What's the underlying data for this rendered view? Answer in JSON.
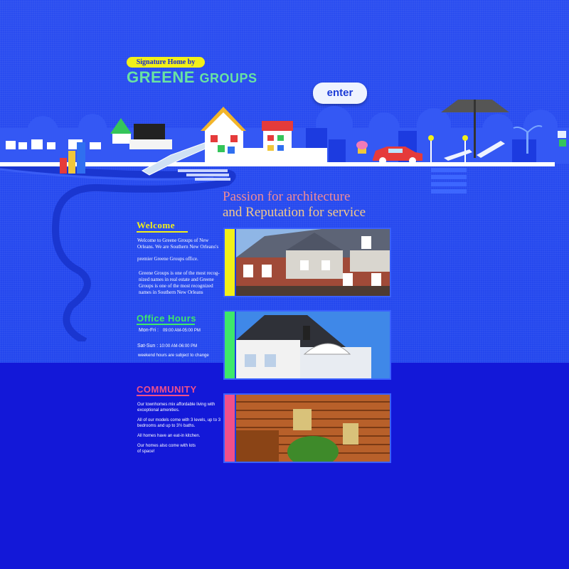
{
  "header": {
    "badge": "Signature Home by",
    "logo_main": "GREENE",
    "logo_sub": "GROUPS",
    "enter_label": "enter"
  },
  "tagline": {
    "line1": "Passion for architecture",
    "line2": "and Reputation for service"
  },
  "welcome": {
    "title": "Welcome",
    "para1a": "Welcome to Greene Groups of New",
    "para1b": "Orleans. We are Southern New Orleans's",
    "para1c": "premier Greene Groups office.",
    "para2a": "Greene Groups is one of the most recog-",
    "para2b": "nized names in real estate and Greene",
    "para2c": "Groups is one of the most recognized",
    "para2d": "names in Southern New Orleans"
  },
  "office": {
    "title": "Office Hours",
    "row1_day": "Mon-Fri :",
    "row1_time": "09:00 AM-05:00 PM",
    "row2_day": "Sat-Sun :",
    "row2_time": "10:00 AM-06:00 PM",
    "note": "weekend hours are subject to change"
  },
  "community": {
    "title": "COMMUNITY",
    "p1a": "Our townhomes mix affordable living with",
    "p1b": "exceptional amenities.",
    "p2a": "All of our models come with 3 levels, up to 3",
    "p2b": "bedrooms and up to 3½ baths.",
    "p3": "All homes have an eat-in kitchen.",
    "p4a": "Our homes also come with lots",
    "p4b": "of space!"
  },
  "colors": {
    "bg_top": "#2347ee",
    "bg_bottom": "#1318d8",
    "welcome_accent": "#f2f018",
    "office_accent": "#3ee86a",
    "community_accent": "#f0508a"
  }
}
